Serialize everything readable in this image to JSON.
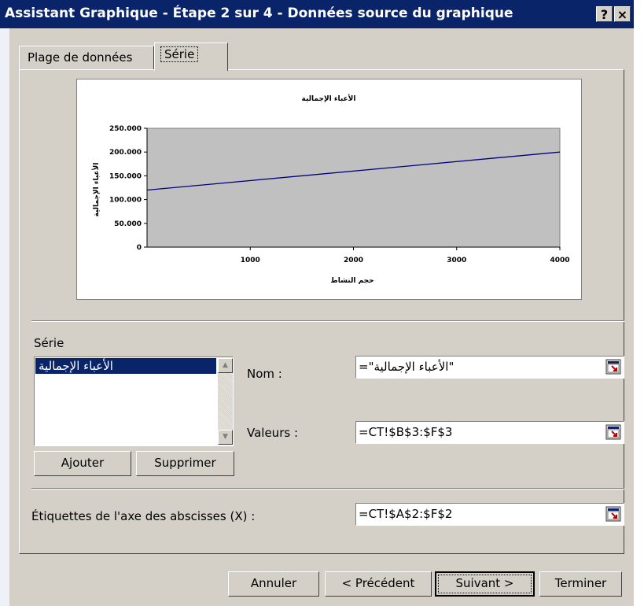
{
  "window": {
    "title": "Assistant Graphique - Étape 2 sur 4 - Données source du graphique",
    "help_label": "?",
    "close_label": "×"
  },
  "tabs": [
    {
      "label": "Plage de données"
    },
    {
      "label": "Série"
    }
  ],
  "chart_data": {
    "type": "line",
    "title": "الأعباء الإجمالية",
    "xlabel": "حجم النشاط",
    "ylabel": "الأعباء الإجمالية",
    "x": [
      0,
      4000
    ],
    "series": [
      {
        "values": [
          120000,
          200000
        ]
      }
    ],
    "xlim": [
      0,
      4000
    ],
    "ylim": [
      0,
      250000
    ],
    "xticks": [
      "1000",
      "2000",
      "3000",
      "4000"
    ],
    "yticks": [
      "250.000",
      "200.000",
      "150.000",
      "100.000",
      "50.000",
      "0"
    ],
    "grid": false,
    "legend": "none",
    "plot_background": "#c0c0c0",
    "line_color": "#000080"
  },
  "series_section": {
    "label": "Série",
    "items": [
      "الأعباء الإجمالية"
    ],
    "add_label": "Ajouter",
    "remove_label": "Supprimer"
  },
  "fields": {
    "nom_label": "Nom :",
    "nom_value": "=\"الأعباء الإجمالية\"",
    "valeurs_label": "Valeurs :",
    "valeurs_value": "=CT!$B$3:$F$3",
    "xlabels_label": "Étiquettes de l'axe des abscisses (X) :",
    "xlabels_value": "=CT!$A$2:$F$2"
  },
  "buttons": {
    "cancel": "Annuler",
    "previous": "< Précédent",
    "next": "Suivant >",
    "finish": "Terminer"
  },
  "colors": {
    "titlebar": "#0a246a",
    "face": "#d4d0c8",
    "selection": "#0a246a"
  }
}
